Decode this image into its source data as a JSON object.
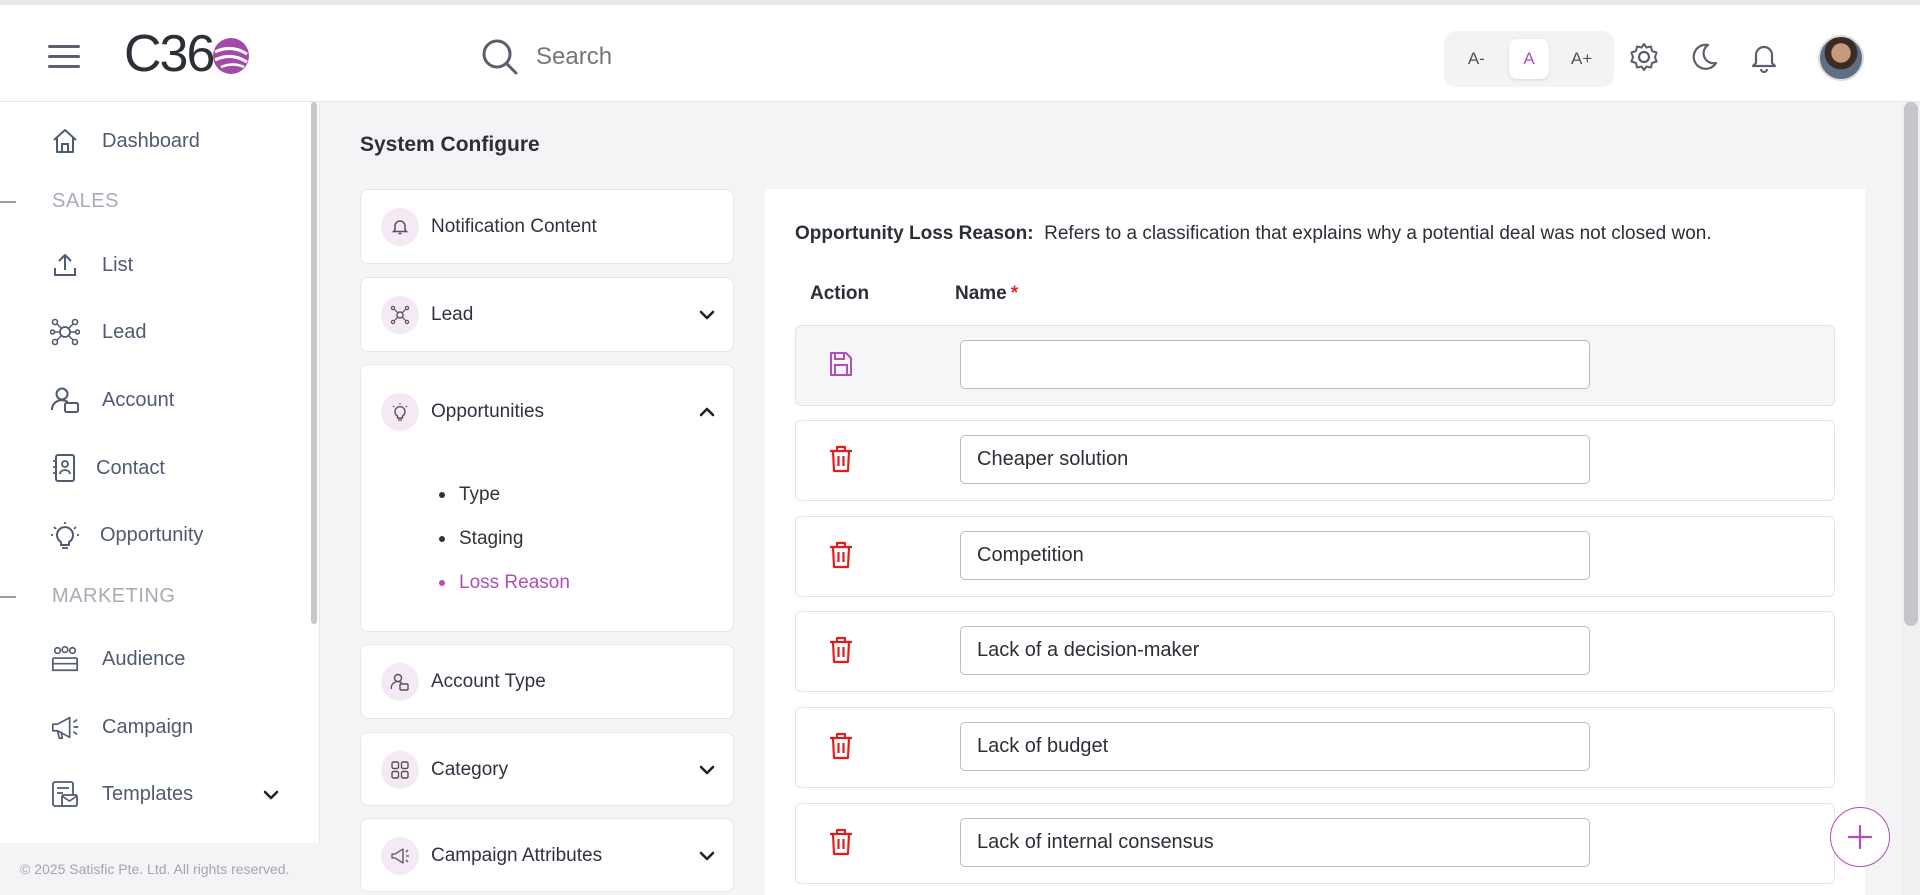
{
  "header": {
    "logo_text": "C36",
    "search_placeholder": "Search",
    "font_sizes": [
      "A-",
      "A",
      "A+"
    ]
  },
  "sidebar": {
    "items": [
      {
        "label": "Dashboard",
        "icon": "home-icon"
      },
      {
        "label": "List",
        "icon": "upload-icon"
      },
      {
        "label": "Lead",
        "icon": "lead-network-icon"
      },
      {
        "label": "Account",
        "icon": "account-icon"
      },
      {
        "label": "Contact",
        "icon": "contact-icon"
      },
      {
        "label": "Opportunity",
        "icon": "lightbulb-icon"
      },
      {
        "label": "Audience",
        "icon": "audience-icon"
      },
      {
        "label": "Campaign",
        "icon": "megaphone-icon"
      },
      {
        "label": "Templates",
        "icon": "templates-icon"
      }
    ],
    "sections": [
      "SALES",
      "MARKETING"
    ],
    "footer": "© 2025 Satisfic Pte. Ltd. All rights reserved."
  },
  "page": {
    "title": "System Configure"
  },
  "config_menu": {
    "notification": "Notification Content",
    "lead": "Lead",
    "opportunities": "Opportunities",
    "opportunity_subitems": [
      "Type",
      "Staging",
      "Loss Reason"
    ],
    "active_subitem": "Loss Reason",
    "account_type": "Account Type",
    "category": "Category",
    "campaign_attributes": "Campaign Attributes"
  },
  "loss_reason": {
    "heading": "Opportunity Loss Reason:",
    "description": "Refers to a classification that explains why a potential deal was not closed won.",
    "col_action": "Action",
    "col_name": "Name",
    "required_mark": "*",
    "new_value": "",
    "rows": [
      "Cheaper solution",
      "Competition",
      "Lack of a decision-maker",
      "Lack of budget",
      "Lack of internal consensus"
    ]
  },
  "colors": {
    "accent": "#b04fb8",
    "danger": "#e01e1e",
    "text": "#2b2f36"
  }
}
